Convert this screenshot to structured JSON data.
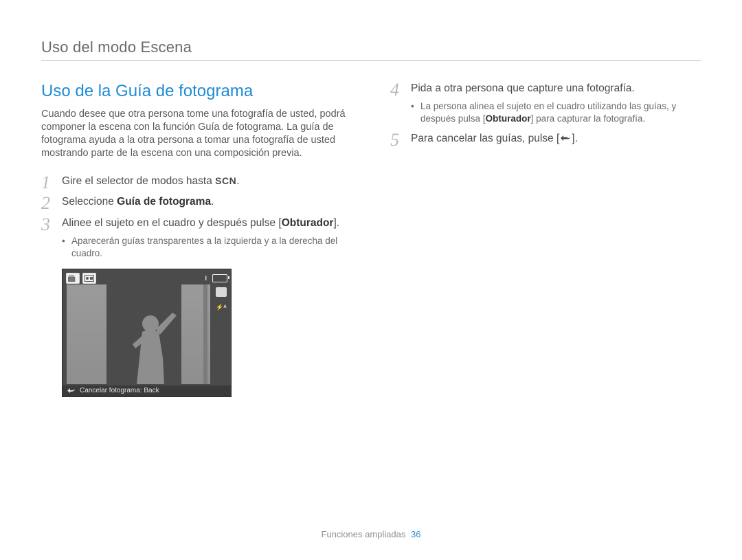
{
  "header": {
    "title": "Uso del modo Escena"
  },
  "main": {
    "section_title": "Uso de la Guía de fotograma",
    "intro": "Cuando desee que otra persona tome una fotografía de usted, podrá componer la escena con la función Guía de fotograma. La guía de fotograma ayuda a la otra persona a tomar una fotografía de usted mostrando parte de la escena con una composición previa.",
    "step1": {
      "text_prefix": "Gire el selector de modos hasta ",
      "mode_icon_label": "SCN",
      "text_suffix": "."
    },
    "step2": {
      "text_prefix": "Seleccione ",
      "bold": "Guía de fotograma",
      "text_suffix": "."
    },
    "step3": {
      "text_prefix": "Alinee el sujeto en el cuadro y después pulse [",
      "bold": "Obturador",
      "text_suffix": "].",
      "sub1": "Aparecerán guías transparentes a la izquierda y a la derecha del cuadro."
    },
    "step4": {
      "text": "Pida a otra persona que capture una fotografía.",
      "sub1_prefix": "La persona alinea el sujeto en el cuadro utilizando las guías, y después pulsa [",
      "sub1_bold": "Obturador",
      "sub1_suffix": "] para capturar la fotografía."
    },
    "step5": {
      "text_prefix": "Para cancelar las guías, pulse [",
      "text_suffix": "]."
    }
  },
  "camera_preview": {
    "top_icons": {
      "scn_badge": "SCN"
    },
    "bottom": {
      "label": "Cancelar fotograma: Back"
    }
  },
  "footer": {
    "text": "Funciones ampliadas",
    "page_number": "36"
  }
}
